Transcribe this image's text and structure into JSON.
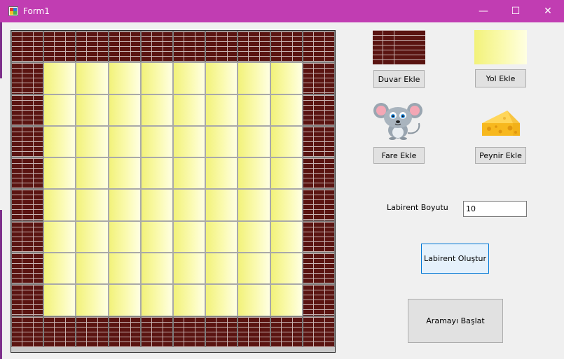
{
  "window": {
    "title": "Form1",
    "minimize_glyph": "—",
    "maximize_glyph": "☐",
    "close_glyph": "✕"
  },
  "maze": {
    "size": 10,
    "layout": [
      "WWWWWWWWWW",
      "WRRRRRRRRW",
      "WRRRRRRRRW",
      "WRRRRRRRRW",
      "WRRRRRRRRW",
      "WRRRRRRRRW",
      "WRRRRRRRRW",
      "WRRRRRRRRW",
      "WRRRRRRRRW",
      "WWWWWWWWWW"
    ]
  },
  "tools": {
    "wall_button": "Duvar Ekle",
    "road_button": "Yol Ekle",
    "mouse_button": "Fare Ekle",
    "cheese_button": "Peynir Ekle"
  },
  "settings": {
    "size_label": "Labirent Boyutu",
    "size_value": "10",
    "create_button": "Labirent Oluştur",
    "start_button": "Aramayı Başlat"
  },
  "colors": {
    "titlebar": "#c13db2",
    "wall": "#5a1411",
    "road": "#f5f591",
    "focus_border": "#0078d7"
  }
}
